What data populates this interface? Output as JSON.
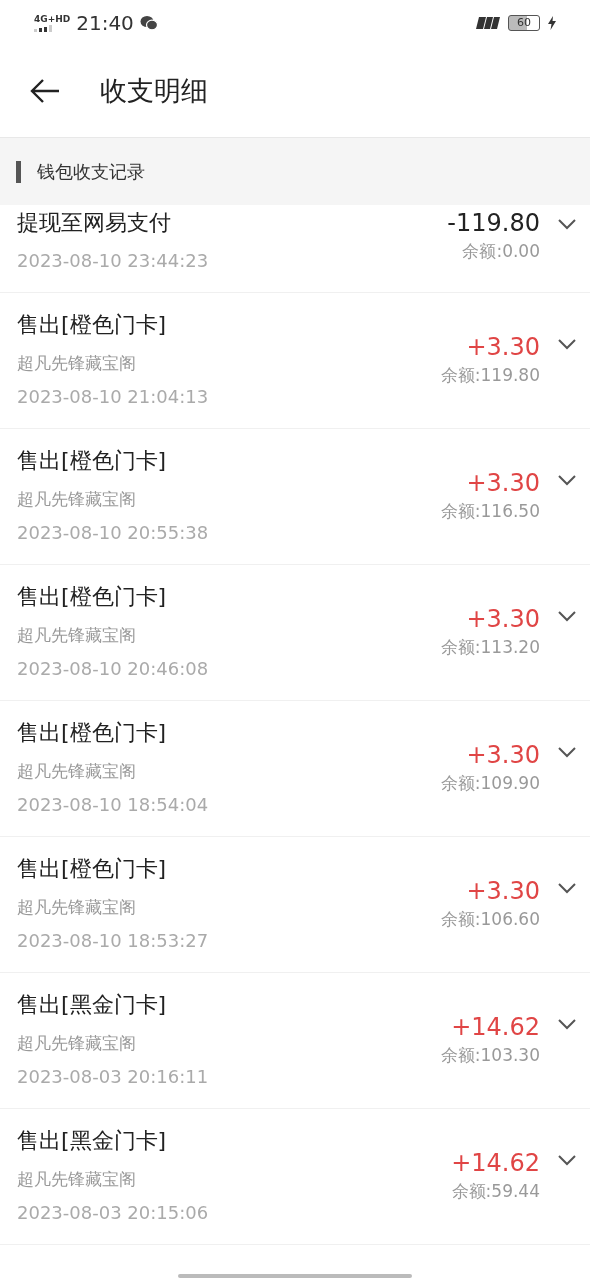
{
  "status_bar": {
    "network": "4G+HD",
    "time": "21:40",
    "battery": "60"
  },
  "header": {
    "title": "收支明细"
  },
  "section": {
    "title": "钱包收支记录"
  },
  "transactions": [
    {
      "kind": "expense",
      "title": "提现至网易支付",
      "date": "2023-08-10 23:44:23",
      "amount": "-119.80",
      "balance": "余额:0.00"
    },
    {
      "kind": "income",
      "title": "售出[橙色门卡]",
      "shop": "超凡先锋藏宝阁",
      "date": "2023-08-10 21:04:13",
      "amount": "+3.30",
      "balance": "余额:119.80"
    },
    {
      "kind": "income",
      "title": "售出[橙色门卡]",
      "shop": "超凡先锋藏宝阁",
      "date": "2023-08-10 20:55:38",
      "amount": "+3.30",
      "balance": "余额:116.50"
    },
    {
      "kind": "income",
      "title": "售出[橙色门卡]",
      "shop": "超凡先锋藏宝阁",
      "date": "2023-08-10 20:46:08",
      "amount": "+3.30",
      "balance": "余额:113.20"
    },
    {
      "kind": "income",
      "title": "售出[橙色门卡]",
      "shop": "超凡先锋藏宝阁",
      "date": "2023-08-10 18:54:04",
      "amount": "+3.30",
      "balance": "余额:109.90"
    },
    {
      "kind": "income",
      "title": "售出[橙色门卡]",
      "shop": "超凡先锋藏宝阁",
      "date": "2023-08-10 18:53:27",
      "amount": "+3.30",
      "balance": "余额:106.60"
    },
    {
      "kind": "income",
      "title": "售出[黑金门卡]",
      "shop": "超凡先锋藏宝阁",
      "date": "2023-08-03 20:16:11",
      "amount": "+14.62",
      "balance": "余额:103.30"
    },
    {
      "kind": "income",
      "title": "售出[黑金门卡]",
      "shop": "超凡先锋藏宝阁",
      "date": "2023-08-03 20:15:06",
      "amount": "+14.62",
      "balance": "余额:59.44"
    }
  ]
}
